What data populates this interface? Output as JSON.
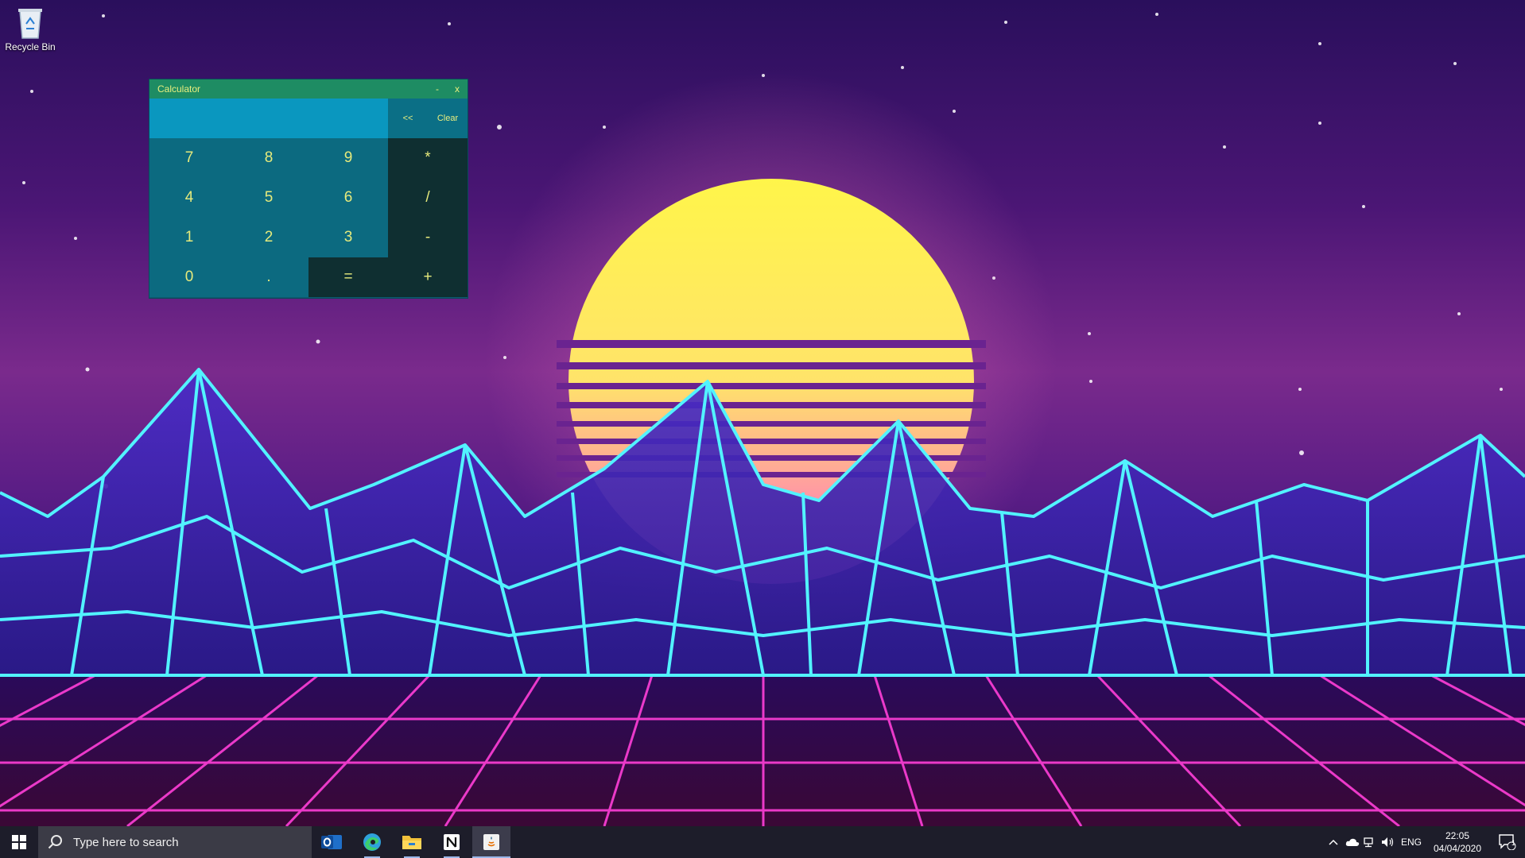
{
  "desktop": {
    "icons": [
      {
        "label": "Recycle Bin",
        "icon": "recycle-bin-icon"
      }
    ]
  },
  "calculator": {
    "title": "Calculator",
    "minimize_label": "-",
    "close_label": "x",
    "display_value": "",
    "backspace_label": "<<",
    "clear_label": "Clear",
    "keys": {
      "k7": "7",
      "k8": "8",
      "k9": "9",
      "mul": "*",
      "k4": "4",
      "k5": "5",
      "k6": "6",
      "div": "/",
      "k1": "1",
      "k2": "2",
      "k3": "3",
      "sub": "-",
      "k0": "0",
      "dot": ".",
      "eq": "=",
      "add": "+"
    },
    "colors": {
      "titlebar": "#1e8c63",
      "display": "#0a97bf",
      "number_key": "#0c6a80",
      "operator_key": "#0f2f31",
      "text": "#e6ea7c"
    }
  },
  "taskbar": {
    "search_placeholder": "Type here to search",
    "pinned_apps": [
      "outlook-icon",
      "edge-icon",
      "file-explorer-icon",
      "notion-icon",
      "java-app-icon"
    ],
    "language": "ENG",
    "time": "22:05",
    "date": "04/04/2020",
    "notification_count": "1"
  }
}
